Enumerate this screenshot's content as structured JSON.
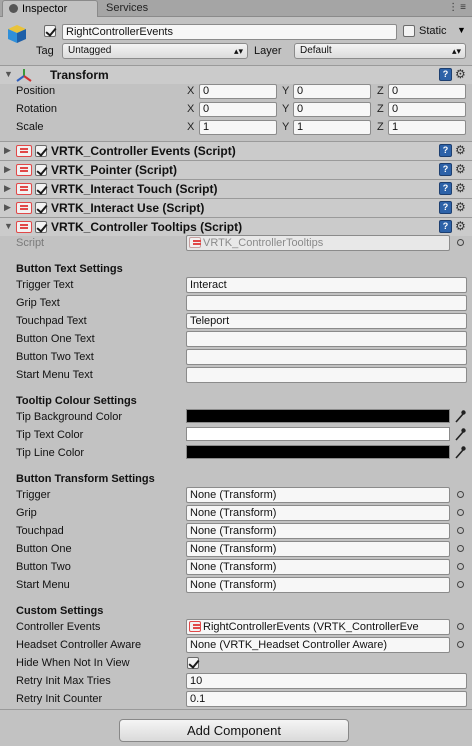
{
  "tabs": [
    {
      "label": "Inspector"
    },
    {
      "label": "Services"
    }
  ],
  "header": {
    "object_name": "RightControllerEvents",
    "static_label": "Static",
    "tag_label": "Tag",
    "tag_value": "Untagged",
    "layer_label": "Layer",
    "layer_value": "Default"
  },
  "transform": {
    "title": "Transform",
    "rows": [
      {
        "label": "Position",
        "x": "0",
        "y": "0",
        "z": "0"
      },
      {
        "label": "Rotation",
        "x": "0",
        "y": "0",
        "z": "0"
      },
      {
        "label": "Scale",
        "x": "1",
        "y": "1",
        "z": "1"
      }
    ],
    "axis": {
      "x": "X",
      "y": "Y",
      "z": "Z"
    }
  },
  "components": [
    {
      "title": "VRTK_Controller Events (Script)"
    },
    {
      "title": "VRTK_Pointer (Script)"
    },
    {
      "title": "VRTK_Interact Touch (Script)"
    },
    {
      "title": "VRTK_Interact Use (Script)"
    }
  ],
  "tooltips": {
    "title": "VRTK_Controller Tooltips (Script)",
    "script_label": "Script",
    "script_value": "VRTK_ControllerTooltips",
    "button_text_section": "Button Text Settings",
    "button_text": [
      {
        "label": "Trigger Text",
        "value": "Interact"
      },
      {
        "label": "Grip Text",
        "value": ""
      },
      {
        "label": "Touchpad Text",
        "value": "Teleport"
      },
      {
        "label": "Button One Text",
        "value": ""
      },
      {
        "label": "Button Two Text",
        "value": ""
      },
      {
        "label": "Start Menu Text",
        "value": ""
      }
    ],
    "colour_section": "Tooltip Colour Settings",
    "colours": [
      {
        "label": "Tip Background Color",
        "color": "#000000"
      },
      {
        "label": "Tip Text Color",
        "color": "#ffffff"
      },
      {
        "label": "Tip Line Color",
        "color": "#000000"
      }
    ],
    "transform_section": "Button Transform Settings",
    "transforms": [
      {
        "label": "Trigger",
        "value": "None (Transform)"
      },
      {
        "label": "Grip",
        "value": "None (Transform)"
      },
      {
        "label": "Touchpad",
        "value": "None (Transform)"
      },
      {
        "label": "Button One",
        "value": "None (Transform)"
      },
      {
        "label": "Button Two",
        "value": "None (Transform)"
      },
      {
        "label": "Start Menu",
        "value": "None (Transform)"
      }
    ],
    "custom_section": "Custom Settings",
    "controller_events_label": "Controller Events",
    "controller_events_value": "RightControllerEvents (VRTK_ControllerEve",
    "headset_aware_label": "Headset Controller Aware",
    "headset_aware_value": "None (VRTK_Headset Controller Aware)",
    "hide_label": "Hide When Not In View",
    "hide_checked": true,
    "retry_max_label": "Retry Init Max Tries",
    "retry_max_value": "10",
    "retry_counter_label": "Retry Init Counter",
    "retry_counter_value": "0.1"
  },
  "add_component_label": "Add Component",
  "help_glyph": "?",
  "gear_glyph": "⚙",
  "fold_open_glyph": "▼",
  "fold_closed_glyph": "▶",
  "window_icons": "⋮≡"
}
